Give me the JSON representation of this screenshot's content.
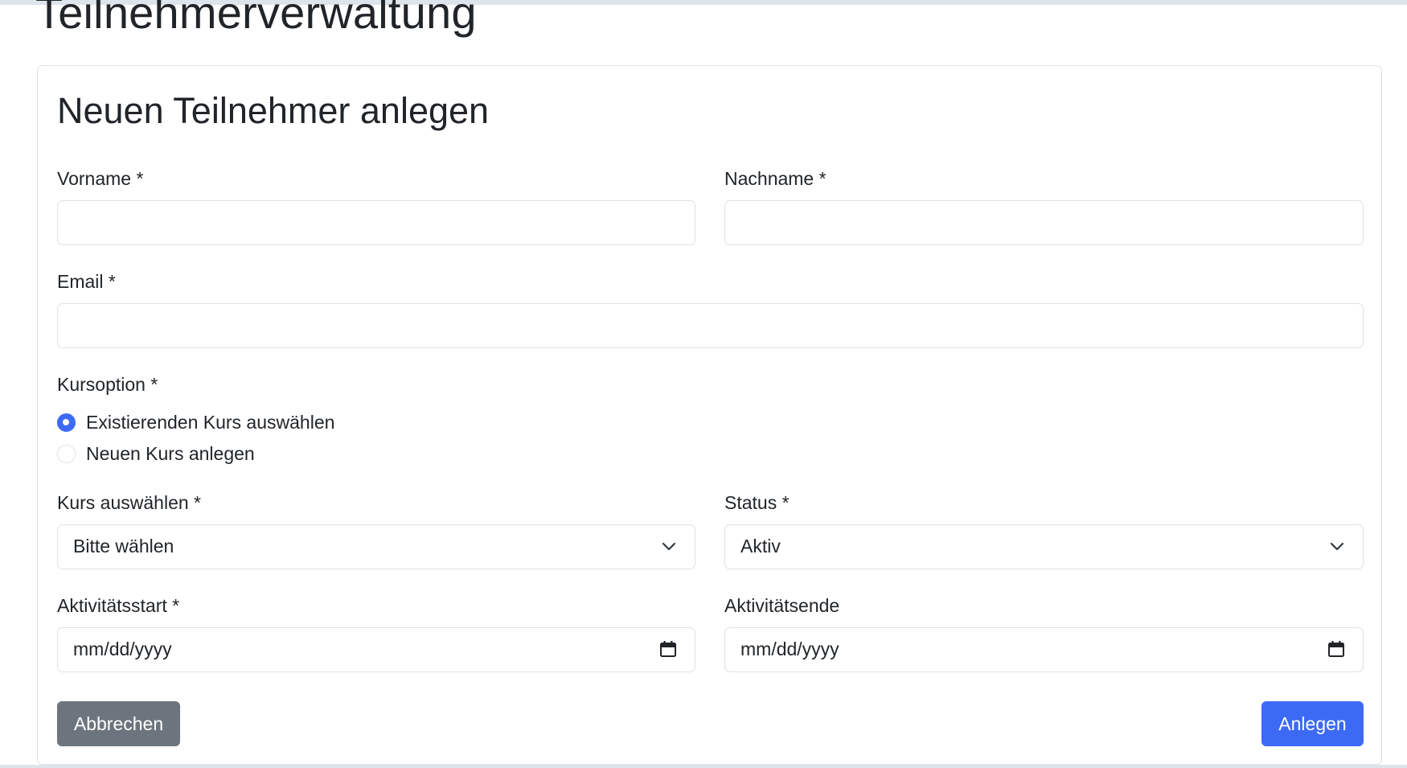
{
  "page": {
    "title": "Teilnehmerverwaltung"
  },
  "form": {
    "title": "Neuen Teilnehmer anlegen",
    "vorname": {
      "label": "Vorname *",
      "value": ""
    },
    "nachname": {
      "label": "Nachname *",
      "value": ""
    },
    "email": {
      "label": "Email *",
      "value": ""
    },
    "kursoption": {
      "label": "Kursoption *",
      "options": [
        {
          "label": "Existierenden Kurs auswählen",
          "checked": true
        },
        {
          "label": "Neuen Kurs anlegen",
          "checked": false
        }
      ]
    },
    "kurs": {
      "label": "Kurs auswählen *",
      "selected": "Bitte wählen"
    },
    "status": {
      "label": "Status *",
      "selected": "Aktiv"
    },
    "aktivitaetsstart": {
      "label": "Aktivitätsstart *",
      "value": "mm/dd/yyyy"
    },
    "aktivitaetsende": {
      "label": "Aktivitätsende",
      "value": "mm/dd/yyyy"
    },
    "buttons": {
      "cancel": "Abbrechen",
      "submit": "Anlegen"
    }
  },
  "icons": {
    "select_arrow": "chevron-down-icon",
    "date_picker": "calendar-icon"
  },
  "colors": {
    "primary": "#3d6af5",
    "secondary": "#6c757d",
    "border": "#dee2e6",
    "text": "#212529"
  }
}
